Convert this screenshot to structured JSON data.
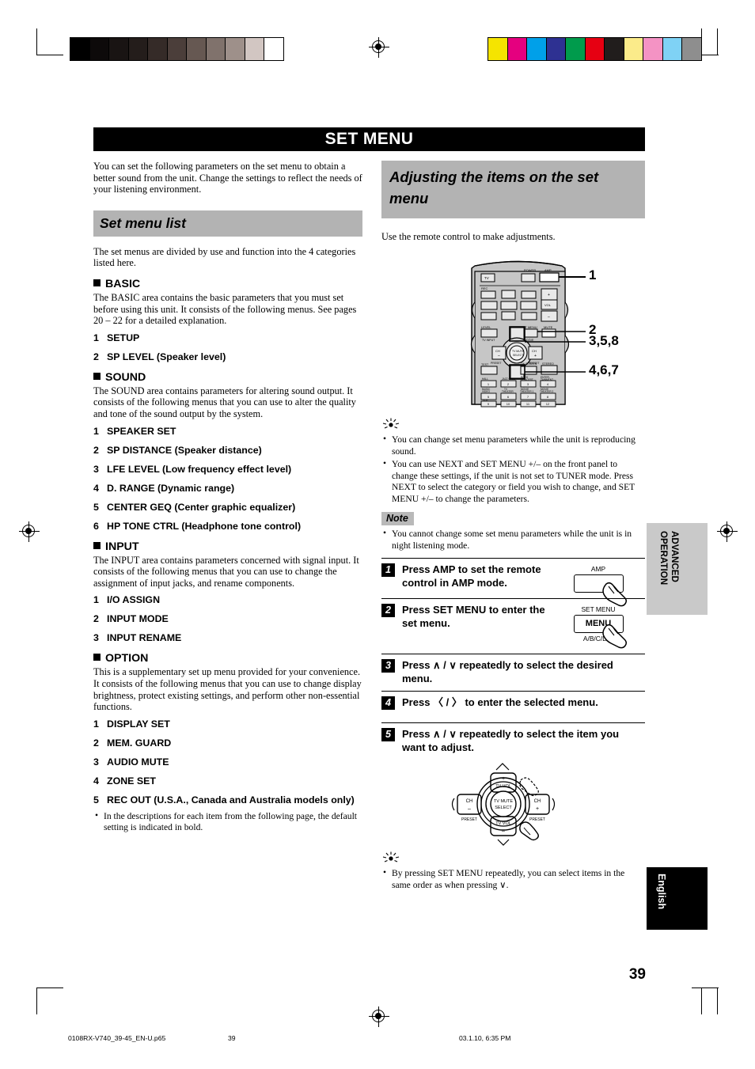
{
  "banner": {
    "title": "SET MENU"
  },
  "left": {
    "intro": "You can set the following parameters on the set menu to obtain a better sound from the unit. Change the settings to reflect the needs of your listening environment.",
    "list_heading": "Set menu list",
    "list_intro": "The set menus are divided by use and function into the 4 categories listed here.",
    "sections": [
      {
        "title": "BASIC",
        "desc": "The BASIC area contains the basic parameters that you must set before using this unit. It consists of the following menus. See pages 20 – 22 for a detailed explanation.",
        "items": [
          {
            "n": "1",
            "label": "SETUP"
          },
          {
            "n": "2",
            "label": "SP LEVEL (Speaker level)"
          }
        ]
      },
      {
        "title": "SOUND",
        "desc": "The SOUND area contains parameters for altering sound output. It consists of the following menus that you can use to alter the quality and tone of the sound output by the system.",
        "items": [
          {
            "n": "1",
            "label": "SPEAKER SET"
          },
          {
            "n": "2",
            "label": "SP DISTANCE (Speaker distance)"
          },
          {
            "n": "3",
            "label": "LFE LEVEL (Low frequency effect level)"
          },
          {
            "n": "4",
            "label": "D. RANGE (Dynamic range)"
          },
          {
            "n": "5",
            "label": "CENTER GEQ (Center graphic equalizer)"
          },
          {
            "n": "6",
            "label": "HP TONE CTRL (Headphone tone control)"
          }
        ]
      },
      {
        "title": "INPUT",
        "desc": "The INPUT area contains parameters concerned with signal input. It consists of the following menus that you can use to change the assignment of input jacks, and rename components.",
        "items": [
          {
            "n": "1",
            "label": "I/O ASSIGN"
          },
          {
            "n": "2",
            "label": "INPUT MODE"
          },
          {
            "n": "3",
            "label": "INPUT RENAME"
          }
        ]
      },
      {
        "title": "OPTION",
        "desc": "This is a supplementary set up menu provided for your convenience. It consists of the following menus that you can use to change display brightness, protect existing settings, and perform other non-essential functions.",
        "items": [
          {
            "n": "1",
            "label": "DISPLAY SET"
          },
          {
            "n": "2",
            "label": "MEM. GUARD"
          },
          {
            "n": "3",
            "label": "AUDIO MUTE"
          },
          {
            "n": "4",
            "label": "ZONE SET"
          },
          {
            "n": "5",
            "label": "REC OUT (U.S.A., Canada and Australia models only)"
          }
        ]
      }
    ],
    "footnote": "In the descriptions for each item from the following page, the default setting is indicated in bold."
  },
  "right": {
    "heading": "Adjusting the items on the set menu",
    "use_remote": "Use the remote control to make adjustments.",
    "callouts": [
      "1",
      "2",
      "3,5,8",
      "4,6,7"
    ],
    "remote": {
      "top_labels": [
        "TV",
        "POWER",
        "AMP"
      ],
      "row_label_rec": "REC",
      "level_label": "LEVEL",
      "setmenu_label": "SET MENU",
      "mute_label": "MUTE",
      "pad": {
        "up": "TV VOL +",
        "down": "TV VOL –",
        "left": "CH –",
        "right": "CH +",
        "left_sub": "PRESET",
        "right_sub": "PRESET",
        "center": "TV MUTE SELECT"
      },
      "numbers": [
        "1",
        "2",
        "3",
        "4",
        "5",
        "6",
        "7",
        "8",
        "9",
        "10",
        "11",
        "12"
      ],
      "number_labels": [
        "HALL",
        "JAZZ CLUB",
        "ROCK CONCERT",
        "ENTER- TAINMENT",
        "MUSIC VIDEO",
        "TV THEATER",
        "MOVIE THEATER 1",
        "MOVIE THEATER 2",
        "■/DTS SUR.",
        "",
        "NIGHT",
        "6.1/ES"
      ]
    },
    "tips_top": [
      "You can change set menu parameters while the unit is reproducing sound.",
      "You can use NEXT and SET MENU +/– on the front panel to change these settings, if the unit is not set to TUNER mode. Press NEXT to select the category or field you wish to change, and SET MENU +/– to change the parameters."
    ],
    "note_label": "Note",
    "notes": [
      "You cannot change some set menu parameters while the unit is in night listening mode."
    ],
    "steps": [
      {
        "n": "1",
        "text": "Press AMP to set the remote control in AMP mode.",
        "art": "amp-key",
        "art_top": "AMP",
        "art_key": "",
        "art_bottom": ""
      },
      {
        "n": "2",
        "text": "Press SET MENU to enter the set menu.",
        "art": "menu-key",
        "art_top": "SET MENU",
        "art_key": "MENU",
        "art_bottom": "A/B/C/D/E"
      },
      {
        "n": "3",
        "text": "Press ∧ / ∨ repeatedly to select the desired menu.",
        "art": "none",
        "art_top": "",
        "art_key": "",
        "art_bottom": ""
      },
      {
        "n": "4",
        "text": "Press 〈 / 〉 to enter the selected menu.",
        "art": "none",
        "art_top": "",
        "art_key": "",
        "art_bottom": ""
      },
      {
        "n": "5",
        "text": "Press ∧ / ∨ repeatedly to select the item you want to adjust.",
        "art": "none",
        "art_top": "",
        "art_key": "",
        "art_bottom": ""
      }
    ],
    "tips_bottom": [
      "By pressing SET MENU repeatedly, you can select items in the same order as when pressing ∨."
    ]
  },
  "side_tabs": {
    "advanced": "ADVANCED\nOPERATION",
    "advanced_line1": "ADVANCED",
    "advanced_line2": "OPERATION",
    "language": "English"
  },
  "page_number": "39",
  "footer": {
    "filename": "0108RX-V740_39-45_EN-U.p65",
    "page": "39",
    "timestamp": "03.1.10, 6:35 PM"
  },
  "colors": {
    "gray_wedge": [
      "#000000",
      "#0d0a0a",
      "#191413",
      "#241d1b",
      "#352b28",
      "#4b3e3a",
      "#665852",
      "#80726c",
      "#9e908a",
      "#d2c6c2",
      "#ffffff"
    ],
    "color_patches": [
      "#f5e400",
      "#e5007f",
      "#00a0e9",
      "#2e3192",
      "#009b4c",
      "#e60012",
      "#211d1c",
      "#fbeb8a",
      "#f493c4",
      "#7fd2f5",
      "#8e8e8e"
    ],
    "accent_gray": "#b3b3b3",
    "banner_bg": "#000000"
  }
}
